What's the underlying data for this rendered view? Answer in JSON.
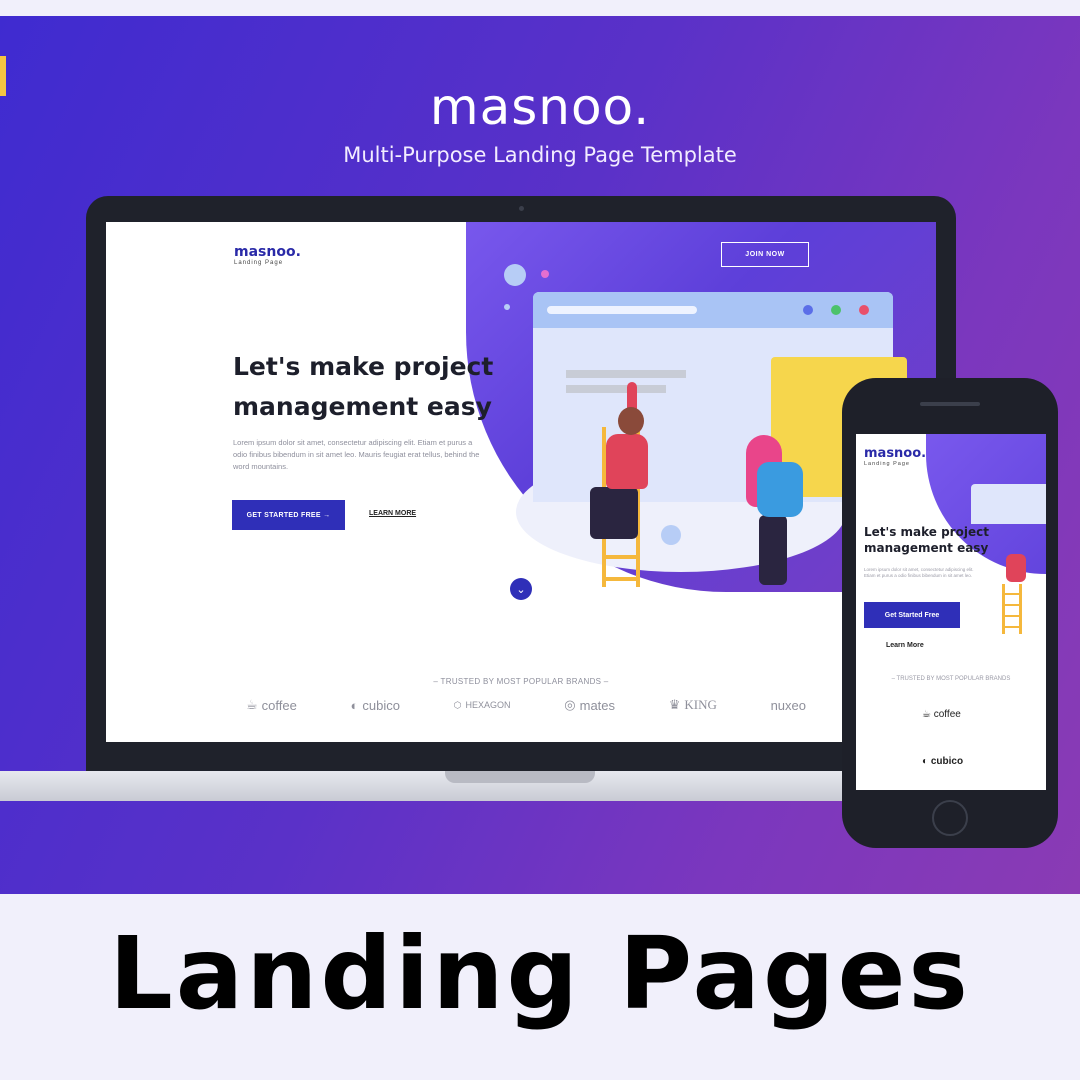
{
  "hero": {
    "brand": "masnoo.",
    "subtitle": "Multi-Purpose Landing Page Template"
  },
  "laptop_site": {
    "logo": "masnoo.",
    "logo_sub": "Landing Page",
    "join": "JOIN NOW",
    "headline": "Let's make project management easy",
    "body": "Lorem ipsum dolor sit amet, consectetur adipiscing elit. Etiam et purus a odio finibus bibendum in sit amet leo. Mauris feugiat erat tellus, behind the word mountains.",
    "cta": "GET STARTED FREE  →",
    "learn_more": "LEARN MORE",
    "scroll_icon": "chevron-down-icon",
    "trusted": "– TRUSTED BY MOST POPULAR BRANDS –",
    "brands": [
      "coffee",
      "cubico",
      "HEXAGON",
      "mates",
      "KING",
      "nuxeo"
    ]
  },
  "phone_site": {
    "logo": "masnoo.",
    "logo_sub": "Landing Page",
    "headline": "Let's make project management easy",
    "body": "Lorem ipsum dolor sit amet, consectetur adipiscing elit. Etiam et purus a odio finibus bibendum in sit amet leo.",
    "cta": "Get Started Free",
    "learn_more": "Learn More",
    "trusted": "– TRUSTED BY MOST POPULAR BRANDS",
    "brands": [
      "coffee",
      "cubico"
    ]
  },
  "footer": {
    "title": "Landing Pages"
  },
  "colors": {
    "gradient_start": "#3f2bd0",
    "gradient_end": "#8a3bb4",
    "cta_blue": "#2f2fb8",
    "accent_yellow": "#f6d64c",
    "accent_pink": "#e0445a"
  }
}
